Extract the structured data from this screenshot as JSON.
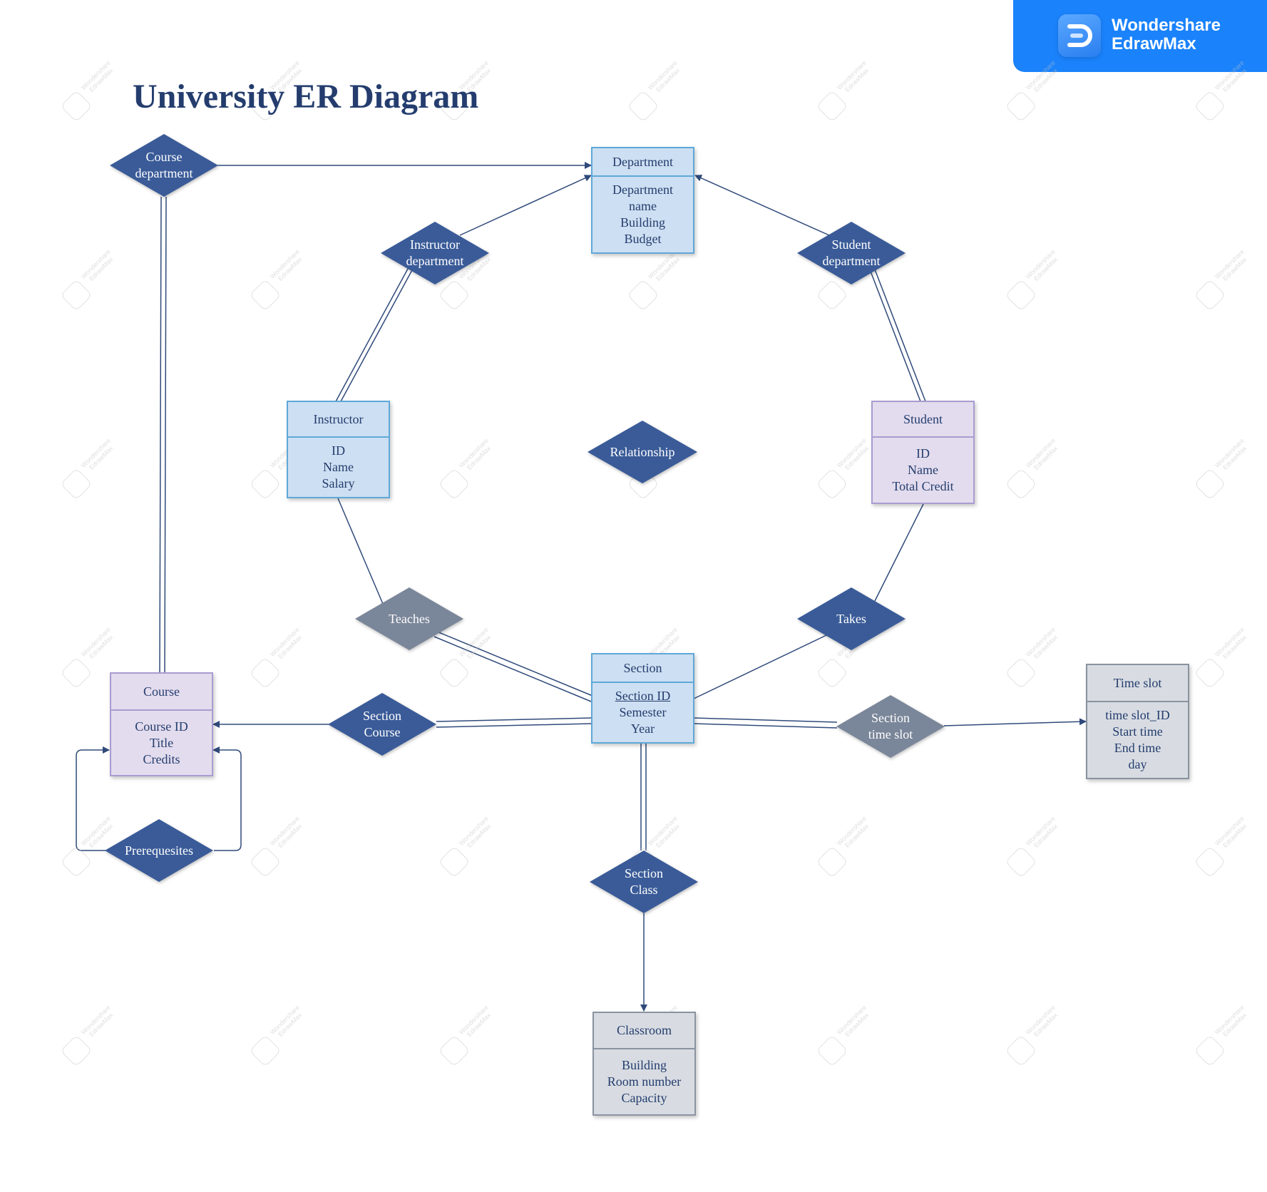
{
  "brand": {
    "line1": "Wondershare",
    "line2": "EdrawMax",
    "color": "#1a82fb"
  },
  "watermark": {
    "line1": "Wondershare",
    "line2": "EdrawMax"
  },
  "title": "University ER Diagram",
  "colors": {
    "relationship_dark": "#3a5b98",
    "relationship_gray": "#7a8699",
    "connector": "#2f4a7a",
    "title": "#243d6e"
  },
  "entities": {
    "department": {
      "name": "Department",
      "attributes": [
        "Department",
        "name",
        "Building",
        "Budget"
      ]
    },
    "instructor": {
      "name": "Instructor",
      "attributes": [
        "ID",
        "Name",
        "Salary"
      ]
    },
    "student": {
      "name": "Student",
      "attributes": [
        "ID",
        "Name",
        "Total Credit"
      ]
    },
    "course": {
      "name": "Course",
      "attributes": [
        "Course ID",
        "Title",
        "Credits"
      ]
    },
    "section": {
      "name": "Section",
      "key_attribute": "Section ID",
      "attributes": [
        "Semester",
        "Year"
      ]
    },
    "time_slot": {
      "name": "Time slot",
      "attributes": [
        "time slot_ID",
        "Start time",
        "End time",
        "day"
      ]
    },
    "classroom": {
      "name": "Classroom",
      "attributes": [
        "Building",
        "Room number",
        "Capacity"
      ]
    }
  },
  "relationships": {
    "course_department": {
      "line1": "Course",
      "line2": "department"
    },
    "instructor_department": {
      "line1": "Instructor",
      "line2": "department"
    },
    "student_department": {
      "line1": "Student",
      "line2": "department"
    },
    "relationship": {
      "line1": "Relationship"
    },
    "teaches": {
      "line1": "Teaches"
    },
    "takes": {
      "line1": "Takes"
    },
    "section_course": {
      "line1": "Section",
      "line2": "Course"
    },
    "section_time_slot": {
      "line1": "Section",
      "line2": "time slot"
    },
    "section_class": {
      "line1": "Section",
      "line2": "Class"
    },
    "prerequesites": {
      "line1": "Prerequesites"
    }
  }
}
